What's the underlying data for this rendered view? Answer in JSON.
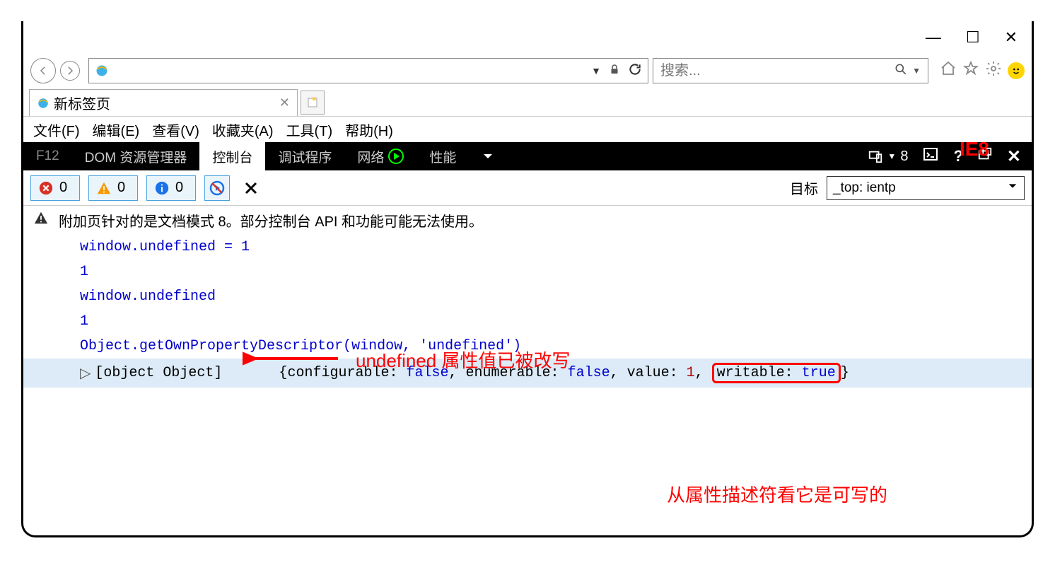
{
  "titlebar": {
    "minimize": "—",
    "maximize": "☐",
    "close": "✕"
  },
  "tab": {
    "title": "新标签页"
  },
  "search": {
    "placeholder": "搜索..."
  },
  "menubar": {
    "file": "文件(F)",
    "edit": "编辑(E)",
    "view": "查看(V)",
    "favorites": "收藏夹(A)",
    "tools": "工具(T)",
    "help": "帮助(H)"
  },
  "devtabs": {
    "f12": "F12",
    "dom": "DOM 资源管理器",
    "console": "控制台",
    "debugger": "调试程序",
    "network": "网络",
    "performance": "性能",
    "emulation_count": "8"
  },
  "filters": {
    "errors": "0",
    "warnings": "0",
    "info": "0"
  },
  "target": {
    "label": "目标",
    "value": "_top: ientp"
  },
  "console": {
    "warning": "附加页针对的是文档模式 8。部分控制台 API 和功能可能无法使用。",
    "line1": "window.undefined = 1",
    "result1": "1",
    "line2": "window.undefined",
    "result2": "1",
    "line3": "Object.getOwnPropertyDescriptor(window, 'undefined')",
    "obj_label": "[object Object]",
    "obj_open": "{",
    "k_configurable": "configurable",
    "v_configurable": "false",
    "k_enumerable": "enumerable",
    "v_enumerable": "false",
    "k_value": "value",
    "v_value": "1",
    "k_writable": "writable",
    "v_writable": "true",
    "obj_close": "}",
    "sep": ": ",
    "comma": ", "
  },
  "annotations": {
    "ie_label": "IE8",
    "note1": "undefined 属性值已被改写",
    "note2": "从属性描述符看它是可写的"
  }
}
